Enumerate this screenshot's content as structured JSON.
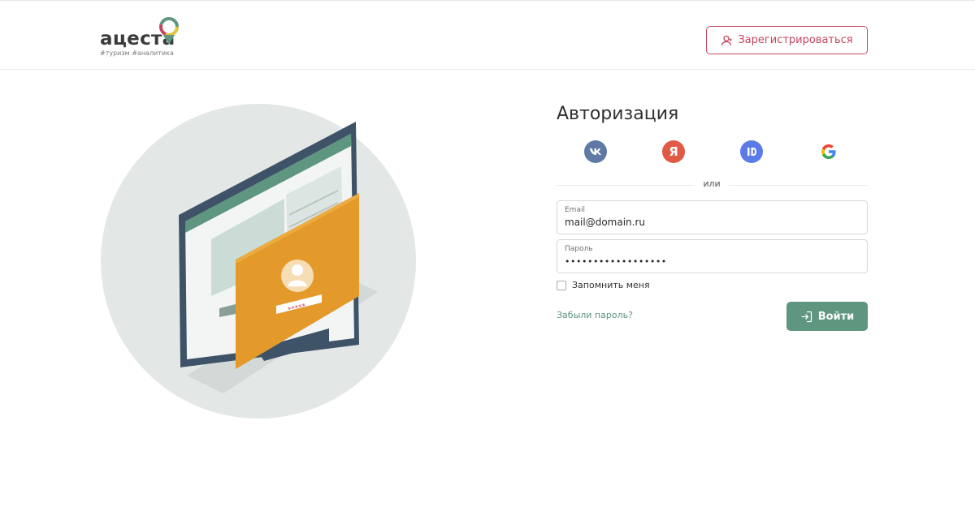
{
  "header": {
    "logo": {
      "word": "ацеста",
      "tags": "#туризм #аналитика"
    },
    "register_label": "Зарегистрироваться"
  },
  "illustration": {
    "password_mask": "*****"
  },
  "auth": {
    "title": "Авторизация",
    "social": [
      {
        "name": "vk",
        "icon": "vk-icon",
        "glyph": "vk",
        "color": "#5e7aa4"
      },
      {
        "name": "yandex",
        "icon": "yandex-icon",
        "glyph": "Я",
        "color": "#e05a44"
      },
      {
        "name": "id",
        "icon": "id-icon",
        "glyph": "ID",
        "color": "#5b7be8"
      },
      {
        "name": "google",
        "icon": "google-icon",
        "glyph": "G",
        "color": "#ffffff"
      }
    ],
    "divider_text": "или",
    "email": {
      "label": "Email",
      "value": "mail@domain.ru"
    },
    "password": {
      "label": "Пароль",
      "value": "••••••••••••••••••"
    },
    "remember_label": "Запомнить меня",
    "forgot_label": "Забыли пароль?",
    "login_label": "Войти"
  },
  "colors": {
    "accent_green": "#5e9680",
    "accent_red": "#c4455e",
    "illustration_circle": "#e3e8e6",
    "card_orange": "#e39a2a"
  }
}
